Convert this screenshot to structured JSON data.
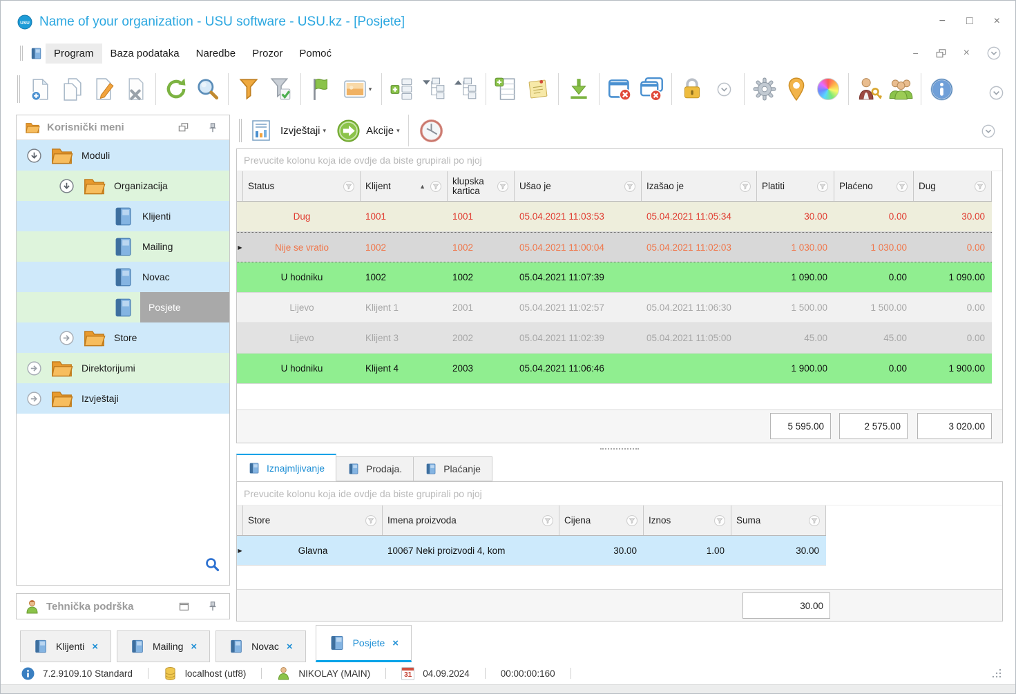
{
  "window": {
    "title": "Name of your organization - USU software - USU.kz - [Posjete]",
    "controls": {
      "minimize": "−",
      "maximize": "□",
      "close": "×"
    }
  },
  "menu": {
    "items": [
      "Program",
      "Baza podataka",
      "Naredbe",
      "Prozor",
      "Pomoć"
    ],
    "active_item": "Program"
  },
  "toolbar": {
    "icons": [
      "new-document",
      "copy-document",
      "edit-document",
      "delete-document",
      "refresh",
      "search",
      "filter",
      "filter-apply",
      "flag",
      "image-preview",
      "add-group",
      "expand-tree",
      "collapse-tree",
      "add-row",
      "notes",
      "export-download",
      "close-window",
      "close-all-windows",
      "lock",
      "more-options",
      "settings",
      "location",
      "color-theme",
      "user-permissions",
      "users",
      "info",
      "more-options"
    ]
  },
  "sidebar": {
    "header": {
      "title": "Korisnički meni"
    },
    "tree": {
      "items": [
        {
          "label": "Moduli",
          "type": "folder",
          "expanded": true
        },
        {
          "label": "Organizacija",
          "type": "folder",
          "expanded": true
        },
        {
          "label": "Klijenti",
          "type": "book"
        },
        {
          "label": "Mailing",
          "type": "book"
        },
        {
          "label": "Novac",
          "type": "book"
        },
        {
          "label": "Posjete",
          "type": "book",
          "selected": true
        },
        {
          "label": "Store",
          "type": "folder",
          "expanded": false
        },
        {
          "label": "Direktorijumi",
          "type": "folder",
          "expanded": false
        },
        {
          "label": "Izvještaji",
          "type": "folder",
          "expanded": false
        }
      ]
    },
    "support_panel": {
      "title": "Tehnička podrška"
    }
  },
  "report_bar": {
    "reports": "Izvještaji",
    "actions": "Akcije"
  },
  "main_table": {
    "group_hint": "Prevucite kolonu koja ide ovdje da biste grupirali po njoj",
    "columns": [
      "Status",
      "Klijent",
      "klupska kartica",
      "Ušao je",
      "Izašao je",
      "Platiti",
      "Plaćeno",
      "Dug"
    ],
    "sorted_column": "Klijent",
    "rows": [
      {
        "status": "Dug",
        "klijent": "1001",
        "kartica": "1001",
        "usao": "05.04.2021 11:03:53",
        "izasao": "05.04.2021 11:05:34",
        "platiti": "30.00",
        "placeno": "0.00",
        "dug": "30.00"
      },
      {
        "status": "Nije se vratio",
        "klijent": "1002",
        "kartica": "1002",
        "usao": "05.04.2021 11:00:04",
        "izasao": "05.04.2021 11:02:03",
        "platiti": "1 030.00",
        "placeno": "1 030.00",
        "dug": "0.00"
      },
      {
        "status": "U hodniku",
        "klijent": "1002",
        "kartica": "1002",
        "usao": "05.04.2021 11:07:39",
        "izasao": "",
        "platiti": "1 090.00",
        "placeno": "0.00",
        "dug": "1 090.00"
      },
      {
        "status": "Lijevo",
        "klijent": "Klijent 1",
        "kartica": "2001",
        "usao": "05.04.2021 11:02:57",
        "izasao": "05.04.2021 11:06:30",
        "platiti": "1 500.00",
        "placeno": "1 500.00",
        "dug": "0.00"
      },
      {
        "status": "Lijevo",
        "klijent": "Klijent 3",
        "kartica": "2002",
        "usao": "05.04.2021 11:02:39",
        "izasao": "05.04.2021 11:05:00",
        "platiti": "45.00",
        "placeno": "45.00",
        "dug": "0.00"
      },
      {
        "status": "U hodniku",
        "klijent": "Klijent 4",
        "kartica": "2003",
        "usao": "05.04.2021 11:06:46",
        "izasao": "",
        "platiti": "1 900.00",
        "placeno": "0.00",
        "dug": "1 900.00"
      }
    ],
    "totals": {
      "platiti": "5 595.00",
      "placeno": "2 575.00",
      "dug": "3 020.00"
    }
  },
  "detail_tabs": {
    "items": [
      {
        "label": "Iznajmljivanje",
        "active": true
      },
      {
        "label": "Prodaja.",
        "active": false
      },
      {
        "label": "Plaćanje",
        "active": false
      }
    ]
  },
  "detail_table": {
    "group_hint": "Prevucite kolonu koja ide ovdje da biste grupirali po njoj",
    "columns": [
      "Store",
      "Imena proizvoda",
      "Cijena",
      "Iznos",
      "Suma"
    ],
    "rows": [
      {
        "store": "Glavna",
        "proizvod": "10067 Neki proizvodi 4, kom",
        "cijena": "30.00",
        "iznos": "1.00",
        "suma": "30.00"
      }
    ],
    "total": "30.00"
  },
  "doc_tabs": {
    "items": [
      {
        "label": "Klijenti",
        "active": false
      },
      {
        "label": "Mailing",
        "active": false
      },
      {
        "label": "Novac",
        "active": false
      },
      {
        "label": "Posjete",
        "active": true
      }
    ]
  },
  "statusbar": {
    "version": "7.2.9109.10 Standard",
    "database": "localhost (utf8)",
    "user": "NIKOLAY (MAIN)",
    "calendar_day": "31",
    "date": "04.09.2024",
    "timer": "00:00:00:160"
  },
  "colors": {
    "accent": "#00a2e8",
    "title_text": "#2ba7e0",
    "row_green": "#90ee90",
    "row_debt_bg": "#eeeedc",
    "debt_text": "#e03a2f",
    "warning_text": "#f0764a",
    "tree_blue": "#cfe9fa",
    "tree_green": "#def4dc",
    "selected_tree": "#a9a9a9"
  }
}
